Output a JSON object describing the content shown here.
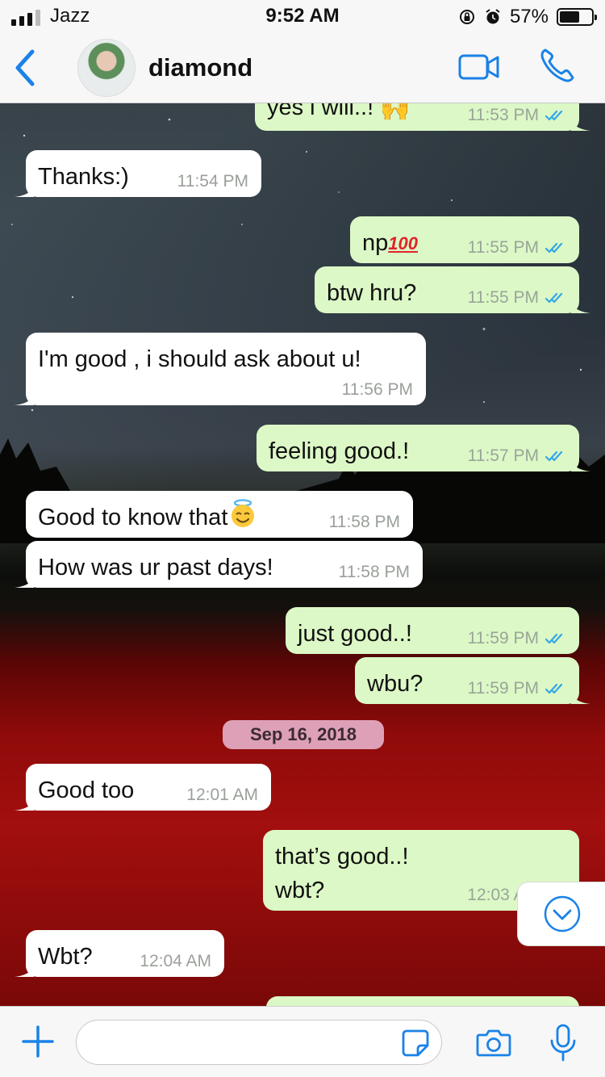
{
  "status_bar": {
    "carrier": "Jazz",
    "time": "9:52 AM",
    "battery_pct": "57%",
    "battery_level": 0.57
  },
  "header": {
    "contact_name": "diamond"
  },
  "colors": {
    "accent": "#1a82e8",
    "incoming": "#ffffff",
    "outgoing": "#dcf8c6",
    "tick_blue": "#34a7e8",
    "date_pill": "#dda0b7"
  },
  "messages": [
    {
      "dir": "out",
      "text": "yes i will..! ",
      "emoji": "raised-hands",
      "time": "11:53 PM",
      "read": true
    },
    {
      "dir": "in",
      "text": "Thanks:)",
      "time": "11:54 PM"
    },
    {
      "dir": "out",
      "text": "np",
      "emoji": "hundred-points",
      "time": "11:55 PM",
      "read": true
    },
    {
      "dir": "out",
      "text": "btw hru?",
      "time": "11:55 PM",
      "read": true
    },
    {
      "dir": "in",
      "text": "I'm good , i should ask about u!",
      "time": "11:56 PM"
    },
    {
      "dir": "out",
      "text": "feeling good.!",
      "time": "11:57 PM",
      "read": true
    },
    {
      "dir": "in",
      "text": "Good to know that",
      "emoji": "smiling-face-with-halo",
      "time": "11:58 PM"
    },
    {
      "dir": "in",
      "text": "How was ur past days!",
      "time": "11:58 PM"
    },
    {
      "dir": "out",
      "text": "just good..!",
      "time": "11:59 PM",
      "read": true
    },
    {
      "dir": "out",
      "text": "wbu?",
      "time": "11:59 PM",
      "read": true
    },
    {
      "dir": "in",
      "text": "Good too",
      "time": "12:01 AM"
    },
    {
      "dir": "out",
      "text": "that’s good..!\nwbt?",
      "time": "12:03 AM",
      "read": true
    },
    {
      "dir": "in",
      "text": "Wbt?",
      "time": "12:04 AM"
    }
  ],
  "date_separator": "Sep 16, 2018",
  "input": {
    "placeholder": ""
  },
  "icons": [
    "back-chevron-icon",
    "video-call-icon",
    "phone-icon",
    "plus-icon",
    "sticker-icon",
    "camera-icon",
    "microphone-icon",
    "chevron-down-icon",
    "read-ticks-icon"
  ]
}
